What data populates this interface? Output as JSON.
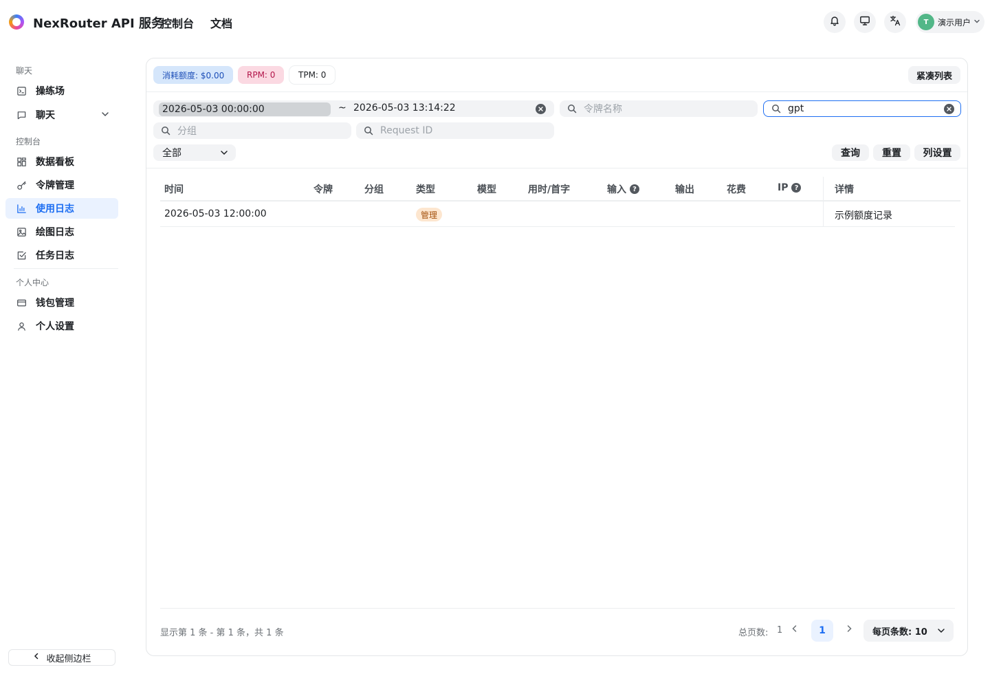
{
  "header": {
    "title": "NexRouter API 服务",
    "nav": [
      "控制台",
      "文档"
    ],
    "icons": [
      "bell-icon",
      "monitor-icon",
      "translate-icon"
    ],
    "user": {
      "initial": "T",
      "name": "演示用户"
    }
  },
  "sidebar": {
    "sections": {
      "chat": "聊天",
      "console": "控制台",
      "personal": "个人中心"
    },
    "items": [
      {
        "label": "操练场",
        "icon": "terminal-icon"
      },
      {
        "label": "聊天",
        "icon": "message-icon"
      },
      {
        "label": "数据看板",
        "icon": "dashboard-icon"
      },
      {
        "label": "令牌管理",
        "icon": "key-icon"
      },
      {
        "label": "使用日志",
        "icon": "bar-chart-icon",
        "active": true
      },
      {
        "label": "绘图日志",
        "icon": "image-icon"
      },
      {
        "label": "任务日志",
        "icon": "check-square-icon"
      },
      {
        "label": "钱包管理",
        "icon": "wallet-icon"
      },
      {
        "label": "个人设置",
        "icon": "user-icon"
      }
    ],
    "collapse_label": "收起侧边栏"
  },
  "stats": {
    "quota": "消耗额度: $0.00",
    "rpm": "RPM: 0",
    "tpm": "TPM: 0",
    "compact_label": "紧凑列表"
  },
  "filters": {
    "date_start": "2026-05-03 00:00:00",
    "date_sep": "~",
    "date_end": "2026-05-03 13:14:22",
    "token_placeholder": "令牌名称",
    "model_value": "gpt",
    "group_placeholder": "分组",
    "request_placeholder": "Request ID",
    "type_value": "全部",
    "query_label": "查询",
    "reset_label": "重置",
    "columns_label": "列设置"
  },
  "table": {
    "columns": [
      "时间",
      "令牌",
      "分组",
      "类型",
      "模型",
      "用时/首字",
      "输入",
      "输出",
      "花费",
      "IP",
      "详情"
    ],
    "rows": [
      {
        "time": "2026-05-03 12:00:00",
        "type": "管理",
        "detail": "示例额度记录"
      }
    ]
  },
  "pagination": {
    "summary": "显示第 1 条 - 第 1 条，共 1 条",
    "total_label": "总页数:",
    "total_pages": "1",
    "current_page": "1",
    "page_size_label": "每页条数: 10"
  },
  "colors": {
    "accent": "#1d6ef2",
    "active_bg": "#eaf2ff",
    "quota_bg": "#d5e6fb",
    "rpm_bg": "#fbd9e2",
    "badge_bg": "#fde6cf"
  }
}
